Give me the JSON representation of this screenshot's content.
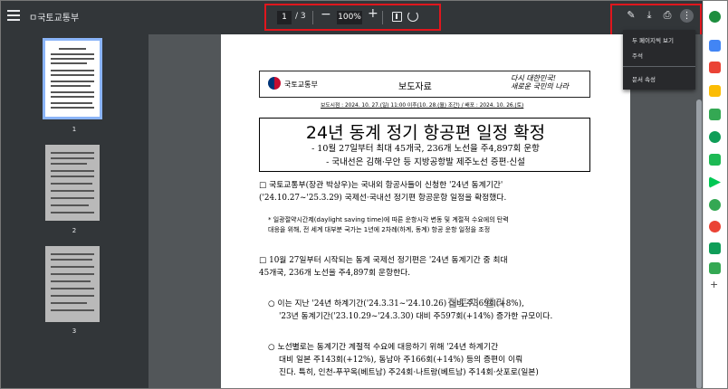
{
  "toolbar": {
    "title": "ㅁ국토교통부",
    "page_current": "1",
    "page_total": "/ 3",
    "zoom": "100%",
    "zoom_minus": "−",
    "zoom_plus": "+"
  },
  "menu": {
    "items": [
      "두 페이지씩 보기",
      "주석",
      "문서 속성"
    ]
  },
  "sidebar": {
    "thumbs": [
      {
        "num": "1"
      },
      {
        "num": "2"
      },
      {
        "num": "3"
      }
    ]
  },
  "doc": {
    "logo_text": "국토교통부",
    "press_label": "보도자료",
    "slogan_line1": "다시 대한민국!",
    "slogan_line2": "새로운 국민의 나라",
    "dates": "보도시점 : 2024. 10. 27.(일) 11:00 이후(10. 28.(월) 조간) / 배포 : 2024. 10. 26.(토)",
    "title": "24년 동계 정기 항공편 일정 확정",
    "sub1": "- 10월 27일부터 최대 45개국, 236개 노선을 주4,897회 운항",
    "sub2": "- 국내선은 김해·무안 등 지방공항발 제주노선 증편·신설",
    "p1_line1": "□ 국토교통부(장관 박상우)는 국내외 항공사들이 신청한 '24년 동계기간'",
    "p1_line2": "('24.10.27~'25.3.29) 국제선·국내선 정기편 항공운항 일정을 확정했다.",
    "note1": "* 일광절약시간제(daylight saving time)에 따른 운항시각 변동 및 계절적 수요에의 탄력",
    "note2": "대응을 위해, 전 세계 대부분 국가는 1년에 2차례(하계, 동계) 항공 운항 일정을 조정",
    "p2_line1": "□ 10월 27일부터 시작되는 동계 국제선 정기편은 '24년 동계기간 중 최대",
    "p2_line2": "45개국, 236개 노선을 주4,897회 운항한다.",
    "b1_line1": "○ 이는 지난 '24년 하계기간('24.3.31~'24.10.26) 대비 주369회(+8%),",
    "b1_line2": "'23년 동계기간('23.10.29~'24.3.30) 대비 주597회(+14%) 증가한 규모이다.",
    "b2_line1": "○ 노선별로는 동계기간 계절적 수요에 대응하기 위해 '24년 하계기간",
    "b2_line2": "대비 일본 주143회(+12%), 동남아 주166회(+14%) 등의 증편이 이뤄",
    "b2_line3": "진다. 특히, 인천-푸꾸옥(베트남) 주24회·나트랑(베트남) 주14회·삿포로(일본)"
  },
  "watermark": "집토끼 엘리",
  "colors": {
    "toolbar_bg": "#323639",
    "viewer_bg": "#525659",
    "highlight": "#e0161d",
    "thumb_selected": "#8ab4f8"
  },
  "icons": [
    "menu-icon",
    "pen-icon",
    "download-icon",
    "print-icon",
    "more-vert-icon",
    "fit-page-icon",
    "rotate-icon"
  ]
}
